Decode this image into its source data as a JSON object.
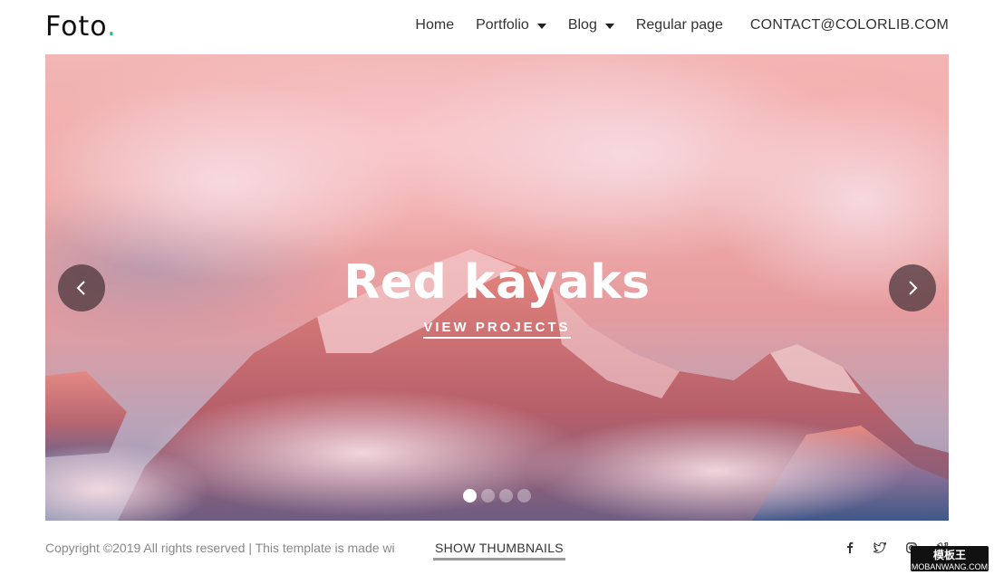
{
  "brand": {
    "name": "Foto",
    "dot": ".",
    "accent": "#1ec27a"
  },
  "nav": {
    "items": [
      {
        "label": "Home",
        "has_caret": false
      },
      {
        "label": "Portfolio",
        "has_caret": true
      },
      {
        "label": "Blog",
        "has_caret": true
      },
      {
        "label": "Regular page",
        "has_caret": false
      }
    ],
    "contact": "CONTACT@COLORLIB.COM"
  },
  "hero": {
    "title": "Red kayaks",
    "link": "VIEW PROJECTS",
    "prev_icon": "chevron-left-icon",
    "next_icon": "chevron-right-icon",
    "slides": {
      "count": 4,
      "active_index": 0
    }
  },
  "footer": {
    "copyright": "Copyright ©2019 All rights reserved | This template is made wi",
    "show_thumbnails": "SHOW THUMBNAILS",
    "social": [
      "facebook-icon",
      "twitter-icon",
      "instagram-icon",
      "vimeo-icon"
    ]
  },
  "watermark": {
    "line1": "模板王",
    "line2": "MOBANWANG.COM"
  }
}
